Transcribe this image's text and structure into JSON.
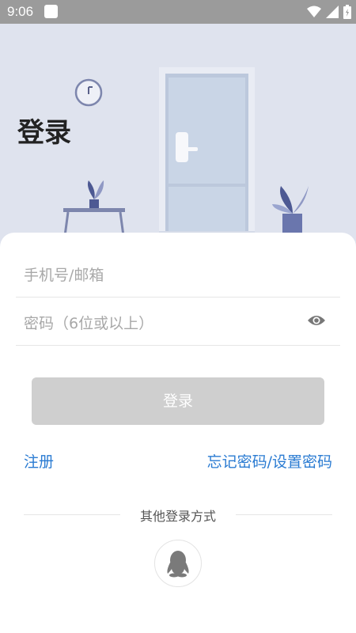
{
  "status": {
    "time": "9:06"
  },
  "title": "登录",
  "form": {
    "account_placeholder": "手机号/邮箱",
    "password_placeholder": "密码（6位或以上）"
  },
  "buttons": {
    "login": "登录",
    "register": "注册",
    "forgot": "忘记密码/设置密码"
  },
  "other_login": {
    "label": "其他登录方式",
    "providers": [
      "qq-icon"
    ]
  },
  "colors": {
    "accent": "#2a7bd2",
    "button_disabled": "#cfcfcf",
    "hero_bg": "#dfe3ee"
  }
}
